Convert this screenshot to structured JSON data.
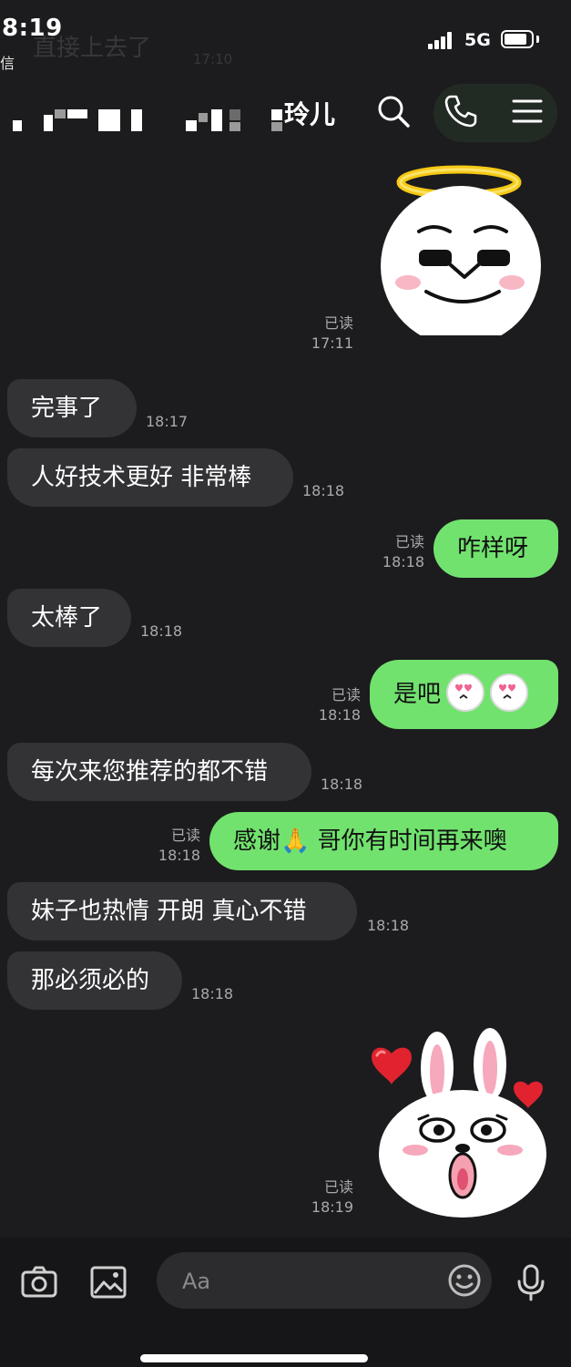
{
  "status_bar": {
    "time": "8:19",
    "sub_label": "信",
    "network": "5G",
    "battery_level": 0.85
  },
  "background_ghost": {
    "text": "直接上去了",
    "time": "17:10"
  },
  "header": {
    "contact_name": "玲儿"
  },
  "messages": [
    {
      "direction": "out",
      "kind": "sticker",
      "sticker": "angel-face-sticker",
      "read_label": "已读",
      "time": "17:11"
    },
    {
      "direction": "in",
      "kind": "text",
      "text": "完事了",
      "time": "18:17"
    },
    {
      "direction": "in",
      "kind": "text",
      "text": "人好技术更好 非常棒",
      "time": "18:18"
    },
    {
      "direction": "out",
      "kind": "text",
      "text": "咋样呀",
      "read_label": "已读",
      "time": "18:18"
    },
    {
      "direction": "in",
      "kind": "text",
      "text": "太棒了",
      "time": "18:18"
    },
    {
      "direction": "out",
      "kind": "text",
      "text": "是吧",
      "emoji": "heart-eyes-face-icon",
      "read_label": "已读",
      "time": "18:18"
    },
    {
      "direction": "in",
      "kind": "text",
      "text": "每次来您推荐的都不错",
      "time": "18:18"
    },
    {
      "direction": "out",
      "kind": "text",
      "text_before": "感谢",
      "emoji": "🙏",
      "text_after": " 哥你有时间再来噢",
      "read_label": "已读",
      "time": "18:18"
    },
    {
      "direction": "in",
      "kind": "text",
      "text": "妹子也热情 开朗 真心不错",
      "time": "18:18"
    },
    {
      "direction": "in",
      "kind": "text",
      "text": "那必须必的",
      "time": "18:18"
    },
    {
      "direction": "out",
      "kind": "sticker",
      "sticker": "bunny-hearts-sticker",
      "read_label": "已读",
      "time": "18:19"
    }
  ],
  "composer": {
    "placeholder": "Aa"
  },
  "colors": {
    "background": "#1c1c1e",
    "incoming_bubble": "#333336",
    "outgoing_bubble": "#71e26e",
    "timestamp": "#a9a9ab"
  }
}
